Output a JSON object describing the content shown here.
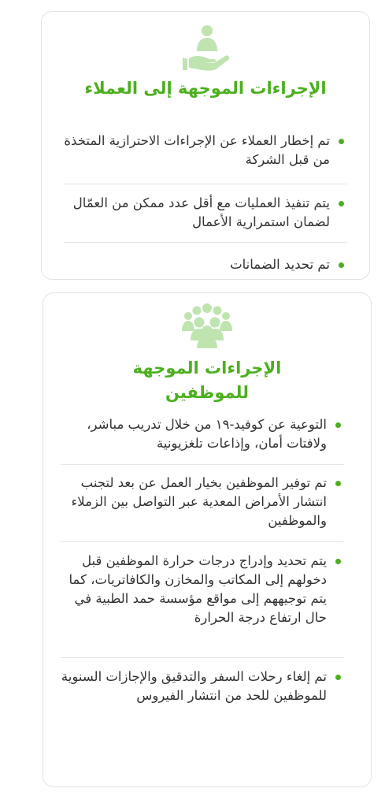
{
  "colors": {
    "accent": "#4caf1f",
    "icon_tint": "#bfe4b0",
    "text": "#333333",
    "border": "#e2e2e2"
  },
  "customers_card": {
    "icon": "hand-holding-person-icon",
    "title": "الإجراءات الموجهة إلى العملاء",
    "items": [
      "تم إخطار العملاء عن الإجراءات الاحترازية المتخذة من قبل الشركة",
      "يتم تنفيذ العمليات مع أقل عدد ممكن من العمّال لضمان استمرارية الأعمال",
      "تم تحديد الضمانات"
    ]
  },
  "employees_card": {
    "icon": "group-of-people-icon",
    "title_line1": "الإجراءات الموجهة",
    "title_line2": "للموظفين",
    "items": [
      "التوعية عن كوفيد-١٩ من خلال تدريب مباشر، ولافتات أمان، وإذاعات تلغزيونية",
      "تم توفير الموظفين بخيار العمل عن بعد لتجنب انتشار الأمراض المعدية عبر التواصل بين الزملاء والموظفين",
      "يتم تحديد وإدراج درجات حرارة الموظفين قبل دخولهم إلى المكاتب والمخازن والكافاتريات، كما يتم توجيههم إلى مواقع مؤسسة حمد الطبية في حال ارتفاع درجة الحرارة",
      "تم إلغاء رحلات السفر والتدقيق والإجازات السنوية للموظفين للحد من انتشار الفيروس"
    ]
  }
}
